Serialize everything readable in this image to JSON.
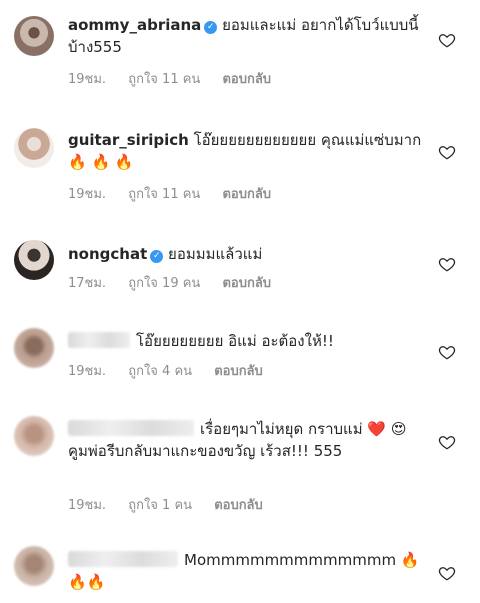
{
  "comments": [
    {
      "username": "aommy_abriana",
      "verified": true,
      "text": " ยอมและแม่ อยากได้โบว์แบบนี้บ้าง555",
      "time": "19ชม.",
      "likes": "ถูกใจ 11 คน",
      "reply": "ตอบกลับ"
    },
    {
      "username": "guitar_siripich",
      "verified": false,
      "text": " โอ๊ยยยยยยยยยยยย คุณแม่แซ่บมาก 🔥 🔥 🔥",
      "time": "19ชม.",
      "likes": "ถูกใจ 11 คน",
      "reply": "ตอบกลับ"
    },
    {
      "username": "nongchat",
      "verified": true,
      "text": " ยอมมมแล้วแม่",
      "time": "17ชม.",
      "likes": "ถูกใจ 19 คน",
      "reply": "ตอบกลับ"
    },
    {
      "username": "",
      "verified": false,
      "text": "โอ๊ยยยยยยยย อิแม่ อะต้องให้!!",
      "time": "19ชม.",
      "likes": "ถูกใจ 4 คน",
      "reply": "ตอบกลับ"
    },
    {
      "username": "",
      "verified": false,
      "text": "เรื่อยๆมาไม่หยุด กราบแม่ ❤️ 😍 คูมพ่อรีบกลับมาแกะของขวัญ เร้วส!!! 555",
      "time": "19ชม.",
      "likes": "ถูกใจ 1 คน",
      "reply": "ตอบกลับ"
    },
    {
      "username": "",
      "verified": false,
      "text": "Mommmmmmmmmmmmm 🔥🔥🔥",
      "time": "",
      "likes": "",
      "reply": ""
    }
  ],
  "icons": {
    "like": "heart-outline-icon",
    "verified": "verified-badge-icon"
  },
  "colors": {
    "text": "#262626",
    "meta": "#8e8e8e",
    "verified": "#3897f0"
  }
}
